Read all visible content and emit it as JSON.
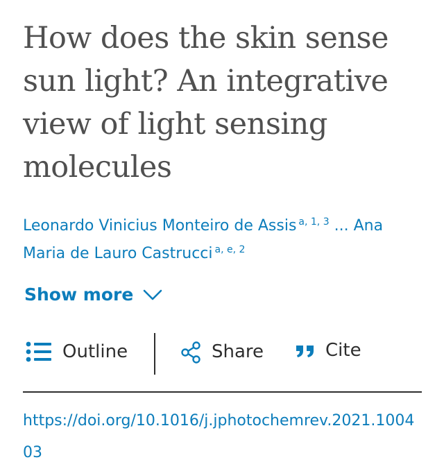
{
  "article": {
    "title": "How does the skin sense sun light? An integrative view of light sensing molecules",
    "authors": {
      "first": {
        "name": "Leonardo Vinicius Monteiro de Assis",
        "affiliations": "a, 1, 3"
      },
      "ellipsis": "...",
      "last": {
        "name": "Ana Maria de Lauro Castrucci",
        "affiliations": "a, e, 2"
      }
    },
    "show_more_label": "Show more",
    "doi": "https://doi.org/10.1016/j.jphotochemrev.2021.100403"
  },
  "toolbar": {
    "outline_label": "Outline",
    "share_label": "Share",
    "cite_label": "Cite"
  },
  "icons": {
    "outline": "list-icon",
    "share": "share-icon",
    "cite": "quote-icon",
    "show_more": "chevron-down-icon"
  },
  "colors": {
    "link": "#0c7dbb",
    "text": "#2e2e2e",
    "title": "#505050"
  }
}
